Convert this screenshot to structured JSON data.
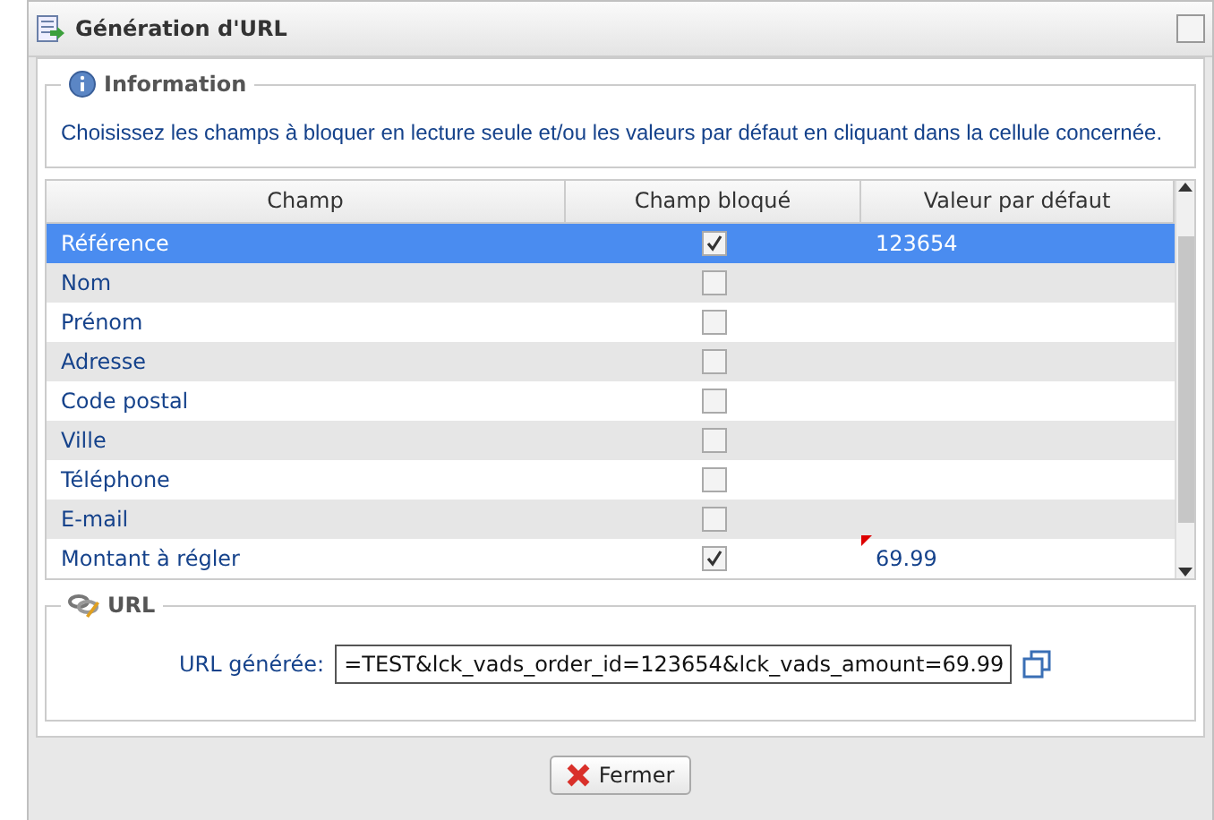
{
  "window": {
    "title": "Génération d'URL"
  },
  "information": {
    "legend": "Information",
    "text": "Choisissez les champs à bloquer en lecture seule et/ou les valeurs par défaut en cliquant dans la cellule concernée."
  },
  "table": {
    "columns": [
      "Champ",
      "Champ bloqué",
      "Valeur par défaut"
    ],
    "rows": [
      {
        "name": "Référence",
        "locked": true,
        "value": "123654",
        "selected": true,
        "modified": false
      },
      {
        "name": "Nom",
        "locked": false,
        "selected": false,
        "modified": false
      },
      {
        "name": "Prénom",
        "locked": false,
        "selected": false,
        "modified": false
      },
      {
        "name": "Adresse",
        "locked": false,
        "selected": false,
        "modified": false
      },
      {
        "name": "Code postal",
        "locked": false,
        "selected": false,
        "modified": false
      },
      {
        "name": "Ville",
        "locked": false,
        "selected": false,
        "modified": false
      },
      {
        "name": "Téléphone",
        "locked": false,
        "selected": false,
        "modified": false
      },
      {
        "name": "E-mail",
        "locked": false,
        "selected": false,
        "modified": false
      },
      {
        "name": "Montant à régler",
        "locked": true,
        "value": "69.99",
        "selected": false,
        "modified": true
      }
    ]
  },
  "url": {
    "legend": "URL",
    "label": "URL générée:",
    "value": "=TEST&lck_vads_order_id=123654&lck_vads_amount=69.99"
  },
  "buttons": [
    {
      "label": "Fermer"
    }
  ]
}
